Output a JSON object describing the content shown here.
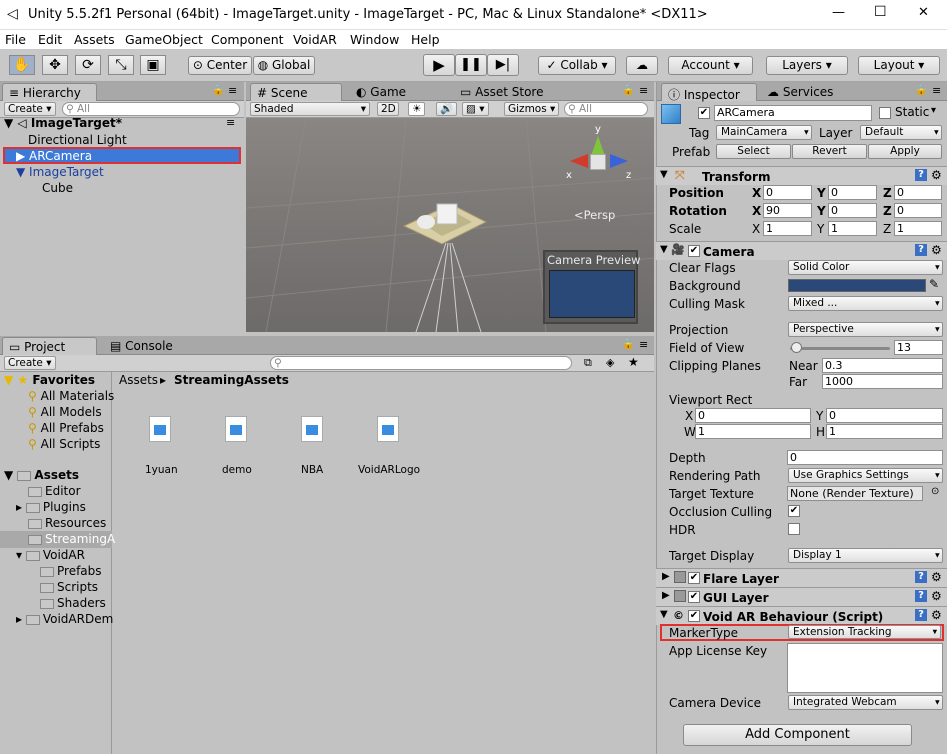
{
  "window": {
    "title": "Unity 5.5.2f1 Personal (64bit) - ImageTarget.unity - ImageTarget - PC, Mac & Linux Standalone* <DX11>",
    "minimize": "—",
    "maximize": "☐",
    "close": "✕"
  },
  "menu": [
    "File",
    "Edit",
    "Assets",
    "GameObject",
    "Component",
    "VoidAR",
    "Window",
    "Help"
  ],
  "toolbar": {
    "center": "Center",
    "global": "Global",
    "collab": "Collab",
    "account": "Account",
    "layers": "Layers",
    "layout": "Layout"
  },
  "hierarchy": {
    "tab": "Hierarchy",
    "create": "Create",
    "search_placeholder": "All",
    "scene": "ImageTarget*",
    "items": [
      "Directional Light",
      "ARCamera",
      "ImageTarget",
      "Cube"
    ]
  },
  "scene": {
    "tabs": [
      "Scene",
      "Game",
      "Asset Store"
    ],
    "shading": "Shaded",
    "mode2d": "2D",
    "gizmos": "Gizmos",
    "search_placeholder": "All",
    "persp": "Persp",
    "preview": "Camera Preview",
    "axes": {
      "x": "x",
      "y": "y",
      "z": "z"
    }
  },
  "project": {
    "tabs": [
      "Project",
      "Console"
    ],
    "create": "Create",
    "favorites_label": "Favorites",
    "favorites": [
      "All Materials",
      "All Models",
      "All Prefabs",
      "All Scripts"
    ],
    "assets_label": "Assets",
    "tree": [
      "Editor",
      "Plugins",
      "Resources",
      "StreamingA",
      "VoidAR",
      "Prefabs",
      "Scripts",
      "Shaders",
      "VoidARDem"
    ],
    "breadcrumb": [
      "Assets",
      "StreamingAssets"
    ],
    "files": [
      "1yuan",
      "demo",
      "NBA",
      "VoidARLogo"
    ]
  },
  "inspector": {
    "tabs": [
      "Inspector",
      "Services"
    ],
    "name": "ARCamera",
    "static": "Static",
    "tag_label": "Tag",
    "tag": "MainCamera",
    "layer_label": "Layer",
    "layer": "Default",
    "prefab_label": "Prefab",
    "select": "Select",
    "revert": "Revert",
    "apply": "Apply",
    "transform": {
      "title": "Transform",
      "position": "Position",
      "rotation": "Rotation",
      "scale": "Scale",
      "pos": [
        "0",
        "0",
        "0"
      ],
      "rot": [
        "90",
        "0",
        "0"
      ],
      "scl": [
        "1",
        "1",
        "1"
      ],
      "x": "X",
      "y": "Y",
      "z": "Z"
    },
    "camera": {
      "title": "Camera",
      "clear_flags": "Clear Flags",
      "clear_flags_val": "Solid Color",
      "background": "Background",
      "culling_mask": "Culling Mask",
      "culling_mask_val": "Mixed ...",
      "projection": "Projection",
      "projection_val": "Perspective",
      "fov": "Field of View",
      "fov_val": "13",
      "clipping": "Clipping Planes",
      "near": "Near",
      "near_val": "0.3",
      "far": "Far",
      "far_val": "1000",
      "viewport": "Viewport Rect",
      "vx": "0",
      "vy": "0",
      "vw": "1",
      "vh": "1",
      "x": "X",
      "y": "Y",
      "w": "W",
      "h": "H",
      "depth": "Depth",
      "depth_val": "0",
      "rendering_path": "Rendering Path",
      "rendering_path_val": "Use Graphics Settings",
      "target_texture": "Target Texture",
      "target_texture_val": "None (Render Texture)",
      "occlusion": "Occlusion Culling",
      "hdr": "HDR",
      "target_display": "Target Display",
      "target_display_val": "Display 1"
    },
    "flare": "Flare Layer",
    "gui": "GUI Layer",
    "voidar": {
      "title": "Void AR Behaviour (Script)",
      "marker_type": "MarkerType",
      "marker_type_val": "Extension Tracking",
      "license": "App License Key",
      "camera_device": "Camera Device",
      "camera_device_val": "Integrated Webcam"
    },
    "add_component": "Add Component"
  },
  "colors": {
    "accent": "#3d79d8",
    "highlight": "#e03030",
    "background_swatch": "#2a4878"
  }
}
